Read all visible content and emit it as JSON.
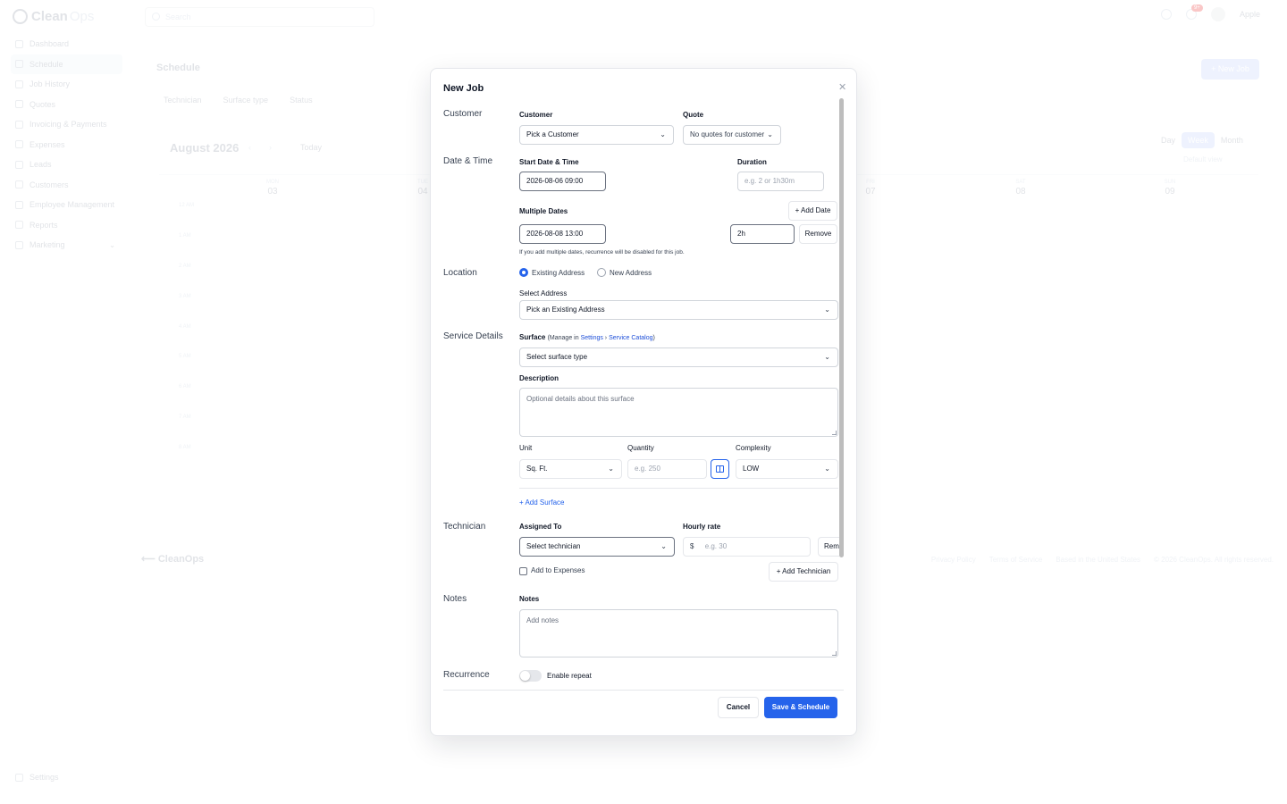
{
  "app": {
    "logo_main": "Clean",
    "logo_accent": "Ops",
    "nav": [
      "Dashboard",
      "Schedule",
      "Job History",
      "Quotes",
      "Invoicing & Payments",
      "Expenses",
      "Leads",
      "Customers",
      "Employee Management",
      "Reports",
      "Marketing"
    ],
    "settings": "Settings",
    "search_placeholder": "Search",
    "notification_count": "9+",
    "user_name": "Apple",
    "page_title": "Schedule",
    "new_job_button": "+  New Job",
    "filters": [
      "Technician",
      "Surface type",
      "Status"
    ],
    "month": "August 2026",
    "today": "Today",
    "views": [
      "Day",
      "Week",
      "Month"
    ],
    "default_view": "Default view",
    "days": [
      {
        "dow": "MON",
        "num": "03"
      },
      {
        "dow": "TUE",
        "num": "04"
      },
      {
        "dow": "FRI",
        "num": "07"
      },
      {
        "dow": "SAT",
        "num": "08"
      },
      {
        "dow": "SUN",
        "num": "09"
      }
    ],
    "hours": [
      "12 AM",
      "1 AM",
      "2 AM",
      "3 AM",
      "4 AM",
      "5 AM",
      "6 AM",
      "7 AM",
      "8 AM"
    ],
    "footer_logo": "CleanOps",
    "footer_links": [
      "Privacy Policy",
      "Terms of Service",
      "Based in the United States",
      "© 2026 CleanOps. All rights reserved."
    ]
  },
  "modal": {
    "title": "New Job",
    "sections": {
      "customer": "Customer",
      "datetime": "Date & Time",
      "location": "Location",
      "service": "Service Details",
      "technician": "Technician",
      "notes": "Notes",
      "recurrence": "Recurrence"
    },
    "customer": {
      "label": "Customer",
      "value": "Pick a Customer",
      "quote_label": "Quote",
      "quote_value": "No quotes for customer"
    },
    "datetime": {
      "start_label": "Start Date & Time",
      "start_value": "2026-08-06 09:00",
      "duration_label": "Duration",
      "duration_placeholder": "e.g. 2 or 1h30m",
      "multiple_label": "Multiple Dates",
      "add_date": "+ Add Date",
      "multi_date_value": "2026-08-08 13:00",
      "multi_duration_value": "2h",
      "remove": "Remove",
      "helper": "If you add multiple dates, recurrence will be disabled for this job."
    },
    "location": {
      "existing": "Existing Address",
      "new": "New Address",
      "select_label": "Select Address",
      "select_value": "Pick an Existing Address"
    },
    "service": {
      "surface_label": "Surface",
      "surface_hint_prefix": "(Manage in ",
      "surface_hint_settings": "Settings",
      "surface_hint_sep": " › ",
      "surface_hint_catalog": "Service Catalog",
      "surface_hint_suffix": ")",
      "surface_value": "Select surface type",
      "description_label": "Description",
      "description_placeholder": "Optional details about this surface",
      "unit_label": "Unit",
      "unit_value": "Sq. Ft.",
      "quantity_label": "Quantity",
      "quantity_placeholder": "e.g. 250",
      "complexity_label": "Complexity",
      "complexity_value": "LOW",
      "add_surface": "+ Add Surface"
    },
    "technician": {
      "assigned_label": "Assigned To",
      "assigned_value": "Select technician",
      "rate_label": "Hourly rate",
      "currency": "$",
      "rate_placeholder": "e.g. 30",
      "remove_partial": "Rem",
      "add_expenses": "Add to Expenses",
      "add_technician": "+ Add Technician"
    },
    "notes": {
      "label": "Notes",
      "placeholder": "Add notes"
    },
    "recurrence": {
      "toggle_label": "Enable repeat"
    },
    "cancel": "Cancel",
    "save": "Save & Schedule"
  }
}
